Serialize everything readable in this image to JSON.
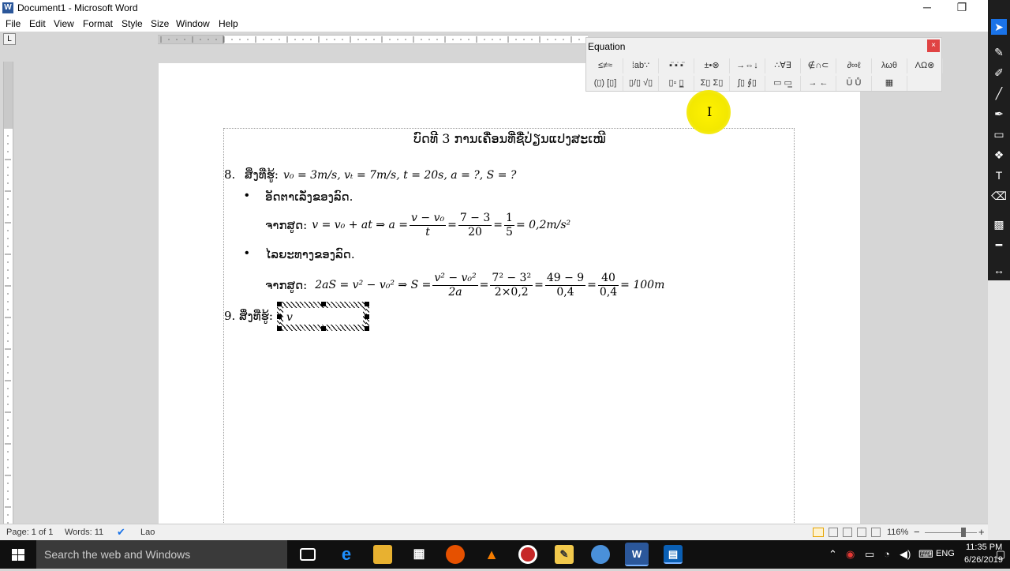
{
  "window": {
    "title": "Document1 - Microsoft Word",
    "app_icon": "W",
    "minimize": "─",
    "restore": "❐"
  },
  "menu": [
    "File",
    "Edit",
    "View",
    "Format",
    "Style",
    "Size",
    "Window",
    "Help"
  ],
  "ruler": {
    "tab_selector": "L"
  },
  "equation_panel": {
    "title": "Equation",
    "close": "×",
    "row1": [
      "≤≠≈",
      "⁞ab∵",
      "▪̈ ▪̇ ▪̈",
      "±•⊗",
      "→⇔↓",
      "∴∀∃",
      "∉∩⊂",
      "∂∞ℓ",
      "λωθ",
      "ΛΩ⊗"
    ],
    "row2": [
      "(▯) [▯]",
      "▯/▯ √▯",
      "▯▫ ▯̲",
      "Σ▯ Σ▯",
      "∫▯ ∮▯",
      "▭ ▭̲",
      "→ ←",
      "Ū Ů",
      "▦"
    ]
  },
  "document": {
    "heading": "ບົດທີ 3 ການເຄື່ອນທີ່ຊື່ປ່ຽນແປງສະເໝີ",
    "p8_num": "8.",
    "p8_label": "ສິ່ງທີ່ຮູ້:",
    "p8_given": "v₀ = 3m/s, vₜ = 7m/s, t = 20s, a = ?, S = ?",
    "b1_text": "ອັດຕາເລັ່ງຂອງລົດ.",
    "b1_lead": "ຈາກສູດ:",
    "b1_formula_a": "v = v₀ + at ⇒ a =",
    "b1_f1_num": "v − v₀",
    "b1_f1_den": "t",
    "b1_eq1": "=",
    "b1_f2_num": "7 − 3",
    "b1_f2_den": "20",
    "b1_eq2": "=",
    "b1_f3_num": "1",
    "b1_f3_den": "5",
    "b1_result": "= 0,2m/s²",
    "b2_text": "ໄລຍະທາງຂອງລົດ.",
    "b2_lead": "ຈາກສູດ:",
    "b2_formula_a": "2aS = v² − v₀² ⇒ S =",
    "b2_f1_num": "v² − v₀²",
    "b2_f1_den": "2a",
    "b2_eq1": "=",
    "b2_f2_num": "7² − 3²",
    "b2_f2_den": "2×0,2",
    "b2_eq2": "=",
    "b2_f3_num": "49 − 9",
    "b2_f3_den": "0,4",
    "b2_eq3": "=",
    "b2_f4_num": "40",
    "b2_f4_den": "0,4",
    "b2_result": "= 100m",
    "p9_num": "9.",
    "p9_label": "ສິ່ງທີ່ຮູ້:",
    "p9_eq": "v"
  },
  "status": {
    "page": "Page: 1 of 1",
    "words": "Words: 11",
    "language": "Lao",
    "zoom": "116%",
    "zoom_minus": "−",
    "zoom_plus": "+"
  },
  "taskbar": {
    "search_placeholder": "Search the web and Windows",
    "lang": "ENG",
    "time": "11:35 PM",
    "date": "6/26/2019"
  }
}
